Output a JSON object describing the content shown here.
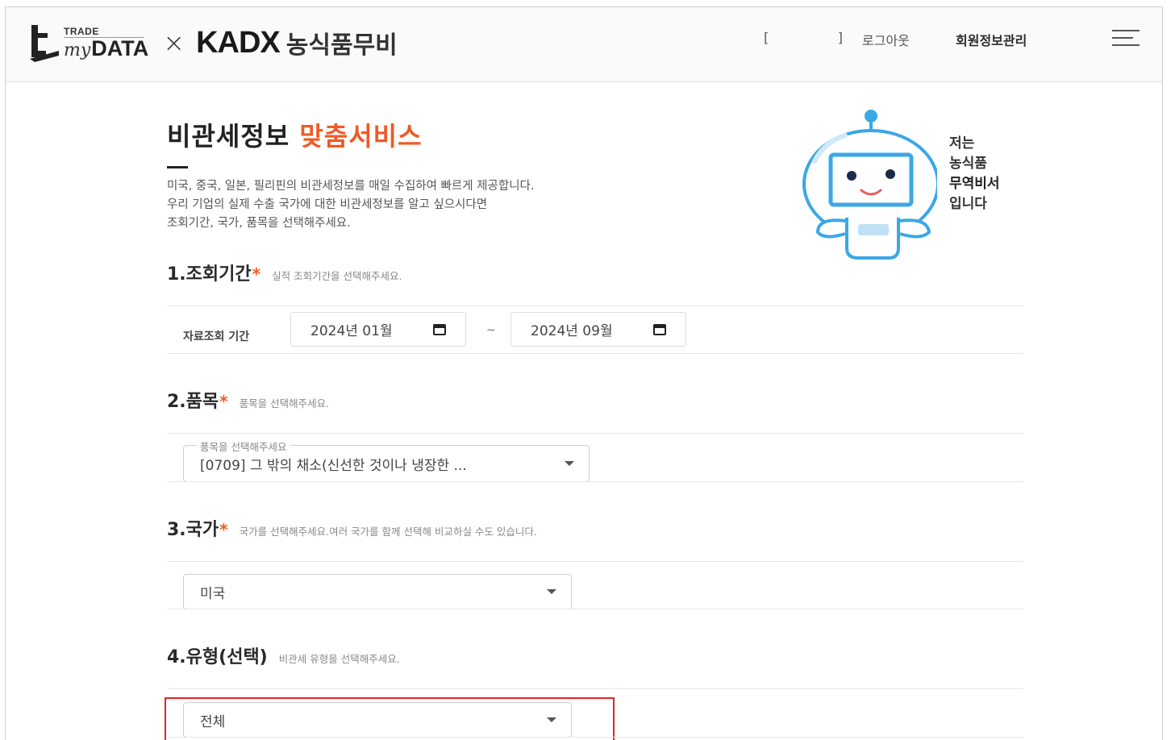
{
  "header": {
    "logo_trade": "TRADE",
    "logo_my": "my",
    "logo_data": "DATA",
    "logo_x": "×",
    "logo_kadx": "KADX",
    "logo_kor": "농식품무비",
    "bracket_open": "[",
    "bracket_close": "]",
    "logout": "로그아웃",
    "member_info": "회원정보관리"
  },
  "intro": {
    "title_main": "비관세정보 ",
    "title_accent": "맞춤서비스",
    "desc_lines": [
      "미국, 중국, 일본, 필리핀의 비관세정보를 매일 수집하여 빠르게 제공합니다.",
      "우리 기업의 실제 수출 국가에 대한 비관세정보를 알고 싶으시다면",
      "조회기간, 국가, 품목을 선택해주세요."
    ],
    "robot_lines": [
      "저는",
      "농식품",
      "무역비서",
      "입니다"
    ]
  },
  "section1": {
    "title": "1.조회기간",
    "star": "*",
    "hint": "실적 조회기간을 선택해주세요.",
    "period_label": "자료조회 기간",
    "start": "2024년 01월",
    "tilde": "~",
    "end": "2024년 09월"
  },
  "section2": {
    "title": "2.품목",
    "star": "*",
    "hint": "품목을 선택해주세요.",
    "float_label": "품목을 선택해주세요",
    "value": "[0709] 그 밖의 채소(신선한 것이나 냉장한 ..."
  },
  "section3": {
    "title": "3.국가",
    "star": "*",
    "hint": "국가를 선택해주세요.여러 국가를 함께 선택해 비교하실 수도 있습니다.",
    "value": "미국"
  },
  "section4": {
    "title": "4.유형(선택)",
    "hint": "비관세 유형을 선택해주세요.",
    "value": "전체"
  },
  "colors": {
    "accent": "#f05a24",
    "highlight": "#e2252b",
    "robot": "#3aa8e6"
  }
}
